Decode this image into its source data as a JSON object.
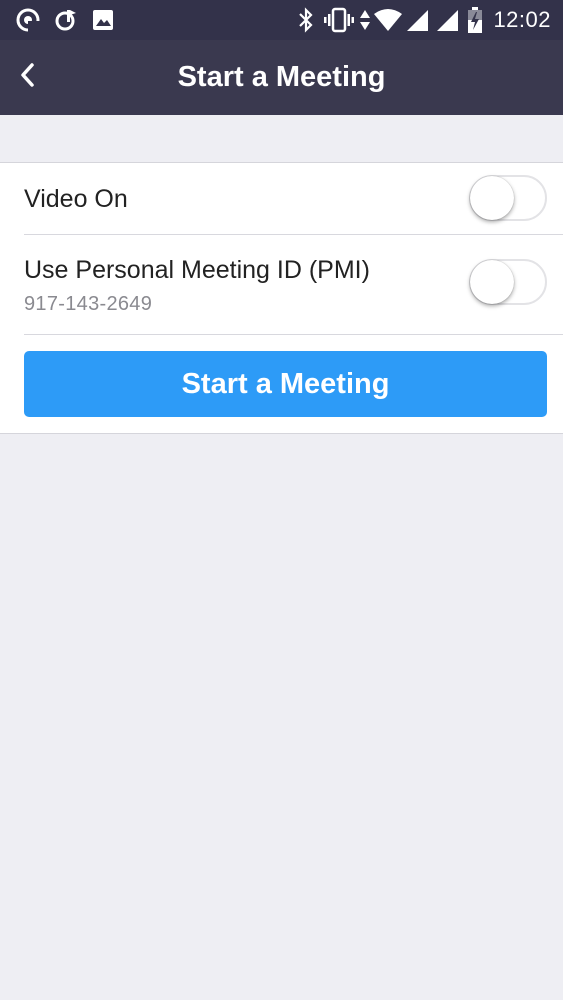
{
  "status_bar": {
    "time": "12:02",
    "icons": [
      "notification-icon",
      "music-note-icon",
      "image-icon",
      "bluetooth-icon",
      "vibrate-icon",
      "data-arrows-icon",
      "wifi-icon",
      "signal-icon",
      "signal-icon-2",
      "battery-charging-icon"
    ]
  },
  "nav": {
    "title": "Start a Meeting",
    "back_icon": "chevron-left-icon"
  },
  "options": {
    "video": {
      "label": "Video On",
      "enabled": false
    },
    "pmi": {
      "label": "Use Personal Meeting ID (PMI)",
      "meeting_id": "917-143-2649",
      "enabled": false
    }
  },
  "actions": {
    "start_label": "Start a Meeting"
  },
  "colors": {
    "status_bar": "#33324a",
    "nav_bar": "#3a394f",
    "background": "#eeeef3",
    "accent": "#2d9bf7"
  }
}
